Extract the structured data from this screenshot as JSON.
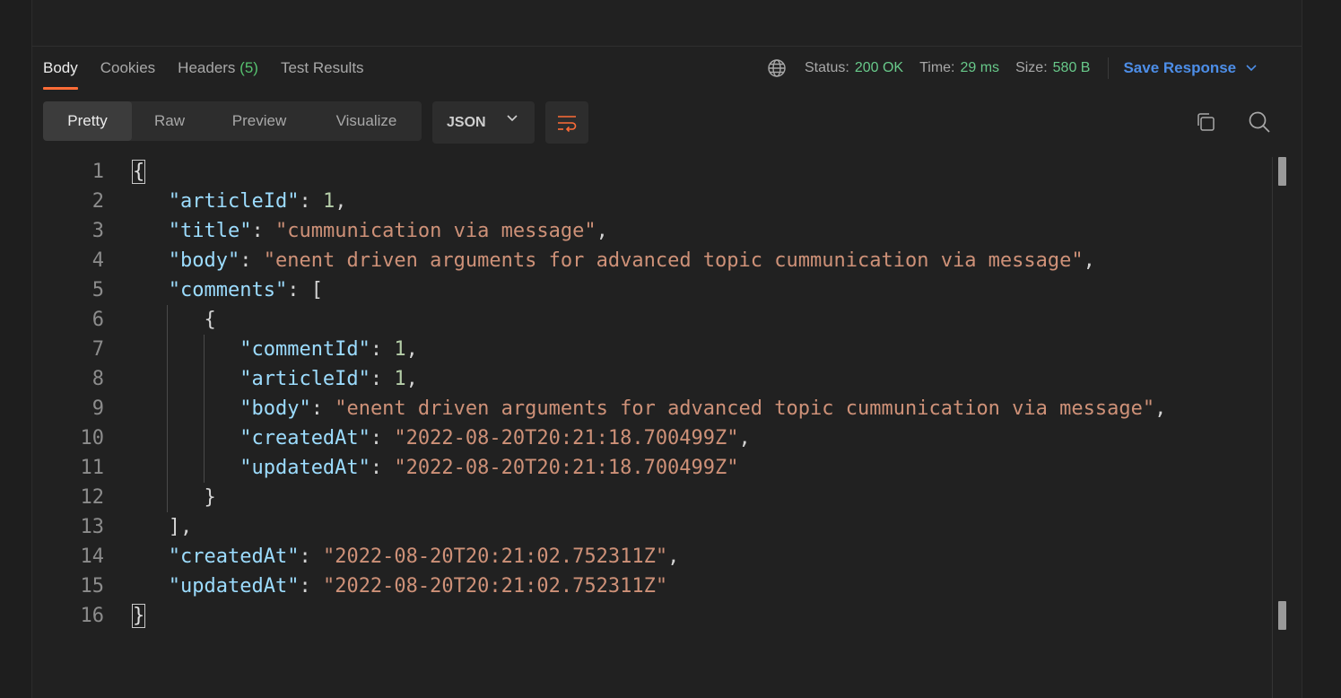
{
  "response_tabs": {
    "body": "Body",
    "cookies": "Cookies",
    "headers": "Headers",
    "headers_count": "(5)",
    "test_results": "Test Results"
  },
  "status": {
    "status_label": "Status:",
    "status_value": "200 OK",
    "time_label": "Time:",
    "time_value": "29 ms",
    "size_label": "Size:",
    "size_value": "580 B",
    "save_response": "Save Response"
  },
  "view_modes": [
    "Pretty",
    "Raw",
    "Preview",
    "Visualize"
  ],
  "format": "JSON",
  "icons": {
    "globe": "globe-icon",
    "wrap": "wrap-lines-icon",
    "copy": "copy-icon",
    "search": "search-icon"
  },
  "colors": {
    "accent": "#ff6c37",
    "status_ok": "#68c98a",
    "link": "#4d8ee8"
  },
  "code": {
    "line_numbers": [
      "1",
      "2",
      "3",
      "4",
      "5",
      "6",
      "7",
      "8",
      "9",
      "10",
      "11",
      "12",
      "13",
      "14",
      "15",
      "16"
    ],
    "articleId_key": "\"articleId\"",
    "articleId_val": "1",
    "title_key": "\"title\"",
    "title_val": "\"cummunication via message\"",
    "body_key": "\"body\"",
    "body_val": "\"enent driven arguments for advanced topic cummunication via message\"",
    "comments_key": "\"comments\"",
    "c_commentId_key": "\"commentId\"",
    "c_commentId_val": "1",
    "c_articleId_key": "\"articleId\"",
    "c_articleId_val": "1",
    "c_body_key": "\"body\"",
    "c_body_val": "\"enent driven arguments for advanced topic cummunication via message\"",
    "c_createdAt_key": "\"createdAt\"",
    "c_createdAt_val": "\"2022-08-20T20:21:18.700499Z\"",
    "c_updatedAt_key": "\"updatedAt\"",
    "c_updatedAt_val": "\"2022-08-20T20:21:18.700499Z\"",
    "createdAt_key": "\"createdAt\"",
    "createdAt_val": "\"2022-08-20T20:21:02.752311Z\"",
    "updatedAt_key": "\"updatedAt\"",
    "updatedAt_val": "\"2022-08-20T20:21:02.752311Z\""
  }
}
